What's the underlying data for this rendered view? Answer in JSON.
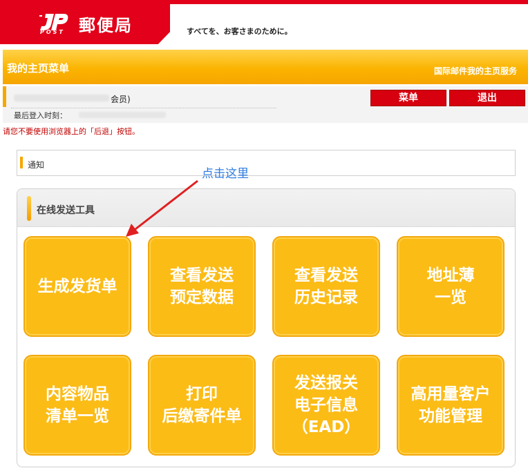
{
  "header": {
    "logo_mark": "JP",
    "logo_post": "POST",
    "brand_name": "郵便局",
    "tagline": "すべてを、お客さまのために。",
    "brand_color": "#e2001a"
  },
  "menubar": {
    "title": "我的主页菜单",
    "service_link": "国际邮件我的主页服务"
  },
  "member": {
    "label_suffix": "会员)",
    "login_label": "最后登入时刻："
  },
  "buttons": {
    "menu": "菜单",
    "logout": "退出"
  },
  "warning": "请您不要使用浏览器上的「后退」按钮。",
  "notice": {
    "title": "通知"
  },
  "annotation": {
    "text": "点击这里",
    "color": "#2f7de1"
  },
  "tools": {
    "title": "在线发送工具",
    "tiles": [
      {
        "line1": "生成发货单",
        "line2": "",
        "line3": ""
      },
      {
        "line1": "查看发送",
        "line2": "预定数据",
        "line3": ""
      },
      {
        "line1": "查看发送",
        "line2": "历史记录",
        "line3": ""
      },
      {
        "line1": "地址薄",
        "line2": "一览",
        "line3": ""
      },
      {
        "line1": "内容物品",
        "line2": "清单一览",
        "line3": ""
      },
      {
        "line1": "打印",
        "line2": "后缴寄件单",
        "line3": ""
      },
      {
        "line1": "发送报关",
        "line2": "电子信息",
        "line3": "（EAD）"
      },
      {
        "line1": "高用量客户",
        "line2": "功能管理",
        "line3": ""
      }
    ],
    "tile_color": "#fcbc16"
  }
}
